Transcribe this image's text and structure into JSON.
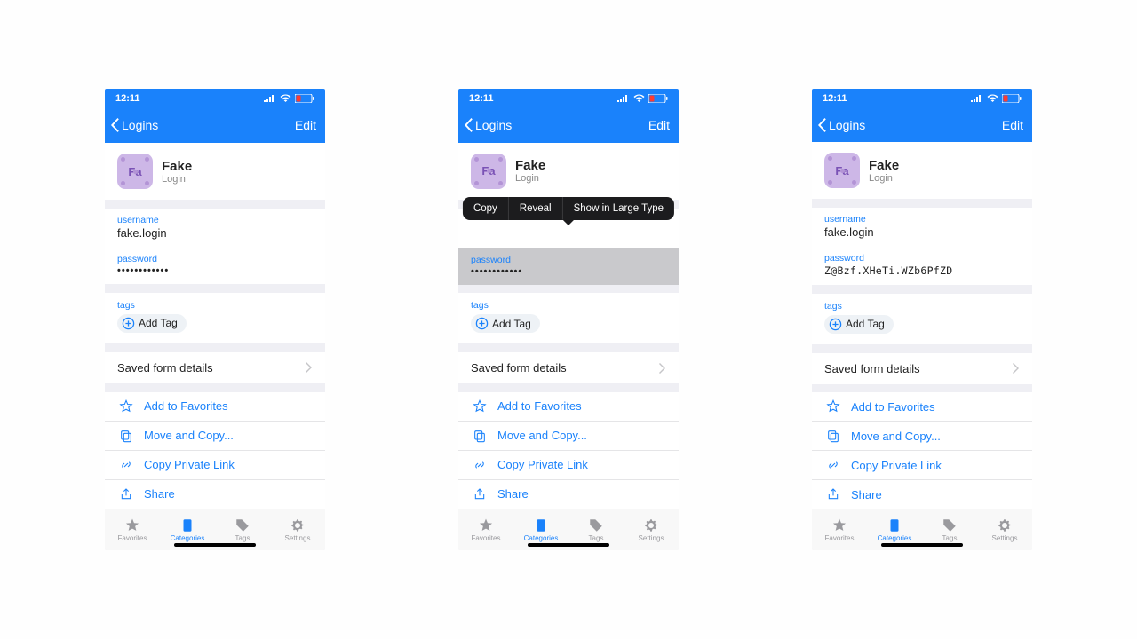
{
  "status": {
    "time": "12:11"
  },
  "nav": {
    "back": "Logins",
    "edit": "Edit"
  },
  "item": {
    "title": "Fake",
    "subtitle": "Login",
    "icon_text": "Fa"
  },
  "fields": {
    "username_label": "username",
    "password_label": "password",
    "tags_label": "tags",
    "add_tag": "Add Tag",
    "saved_form": "Saved form details"
  },
  "popover": {
    "copy": "Copy",
    "reveal": "Reveal",
    "large": "Show in Large Type"
  },
  "values": {
    "username": "fake.login",
    "password_masked": "••••••••••••",
    "password_plain": "Z@Bzf.XHeTi.WZb6PfZD"
  },
  "actions": {
    "favorites": "Add to Favorites",
    "move": "Move and Copy...",
    "private_link": "Copy Private Link",
    "share": "Share"
  },
  "tabs": {
    "favorites": "Favorites",
    "categories": "Categories",
    "tags": "Tags",
    "settings": "Settings"
  }
}
